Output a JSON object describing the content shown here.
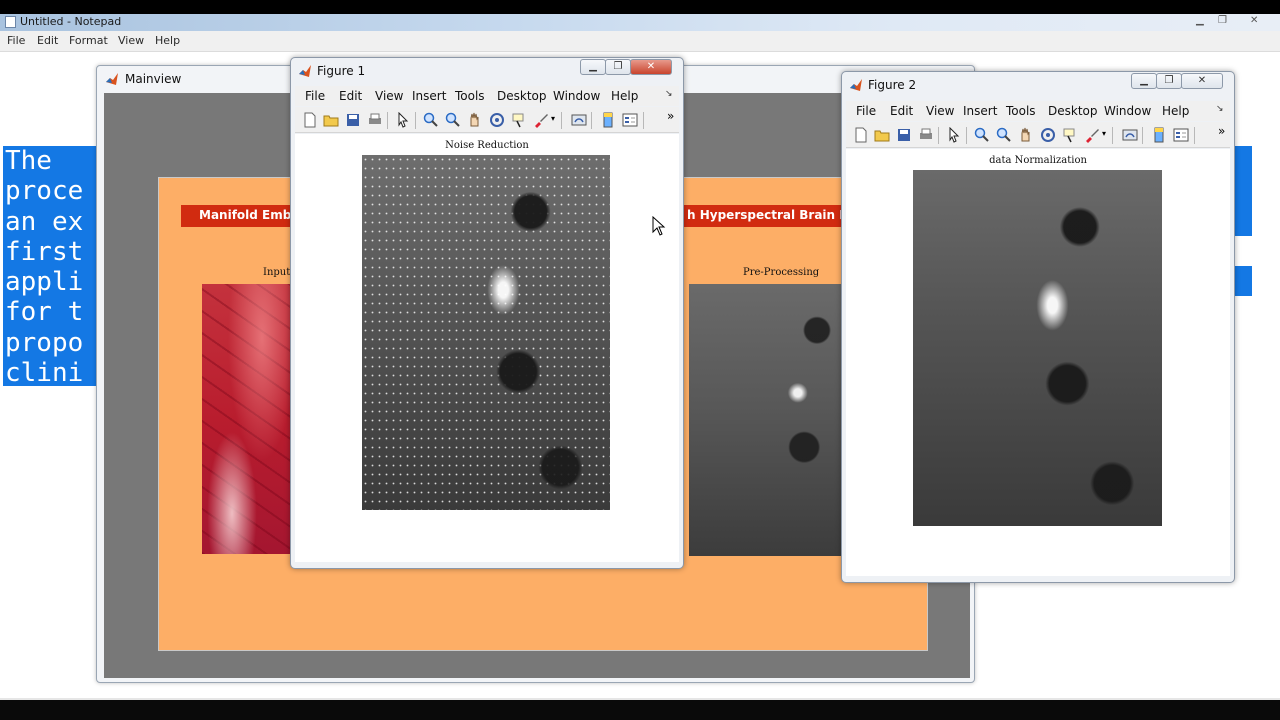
{
  "notepad": {
    "title": "Untitled - Notepad",
    "controls": [
      "▁",
      "❐",
      "✕"
    ],
    "menu": [
      "File",
      "Edit",
      "Format",
      "View",
      "Help"
    ],
    "text_lines": [
      "The ",
      "proce",
      "an ex",
      "first",
      "appli",
      "for t",
      "propo",
      "clini"
    ],
    "selection_color": "#1478e4"
  },
  "mainview": {
    "title": "Mainview",
    "banner_left": "Manifold Embed",
    "banner_right": "h Hyperspectral Brain Ima",
    "caption_input": "Input",
    "caption_preprocessing": "Pre-Processing",
    "panel_color": "#fdae66",
    "banner_color": "#d12b10"
  },
  "figure1": {
    "title": "Figure 1",
    "menu": [
      "File",
      "Edit",
      "View",
      "Insert",
      "Tools",
      "Desktop",
      "Window",
      "Help"
    ],
    "plot_title": "Noise Reduction"
  },
  "figure2": {
    "title": "Figure 2",
    "menu": [
      "File",
      "Edit",
      "View",
      "Insert",
      "Tools",
      "Desktop",
      "Window",
      "Help"
    ],
    "plot_title": "data Normalization"
  },
  "toolbar_icons": [
    "new-figure-icon",
    "open-file-icon",
    "save-icon",
    "print-icon",
    "edit-plot-arrow-icon",
    "zoom-in-icon",
    "zoom-out-icon",
    "pan-hand-icon",
    "rotate-3d-icon",
    "data-cursor-icon",
    "brush-icon",
    "link-plot-icon",
    "colorbar-icon",
    "legend-icon",
    "overflow-chevron-icon"
  ]
}
